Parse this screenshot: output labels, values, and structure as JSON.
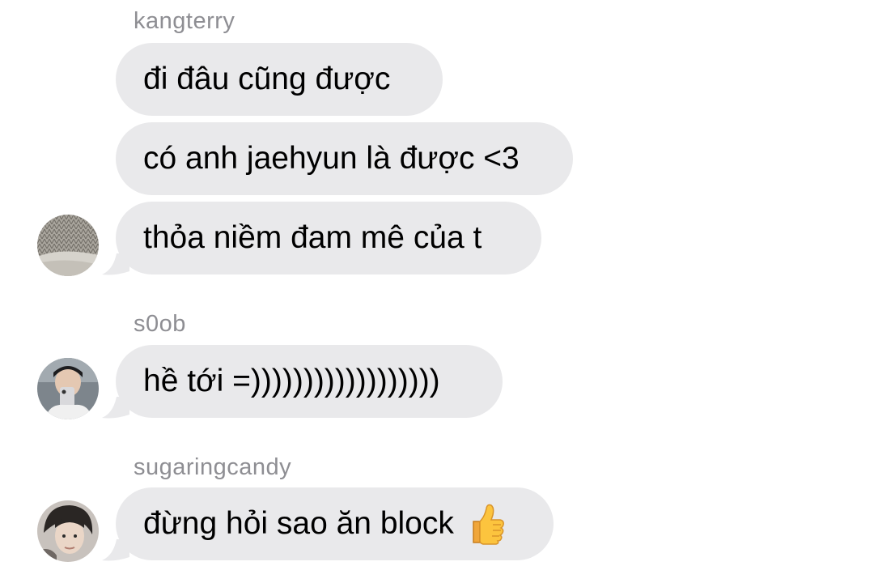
{
  "conversation": {
    "groups": [
      {
        "sender": "kangterry",
        "messages": [
          "đi đâu cũng được",
          "có anh jaehyun là được <3",
          "thỏa niềm đam mê của t"
        ]
      },
      {
        "sender": "s0ob",
        "messages": [
          "hề tới =))))))))))))))))))"
        ]
      },
      {
        "sender": "sugaringcandy",
        "messages": [
          "đừng hỏi sao ăn block"
        ],
        "emoji": "thumbs-up-icon"
      }
    ]
  },
  "colors": {
    "bubble": "#e9e9eb",
    "sender_name": "#8e8e93",
    "text": "#000000",
    "background": "#ffffff"
  }
}
